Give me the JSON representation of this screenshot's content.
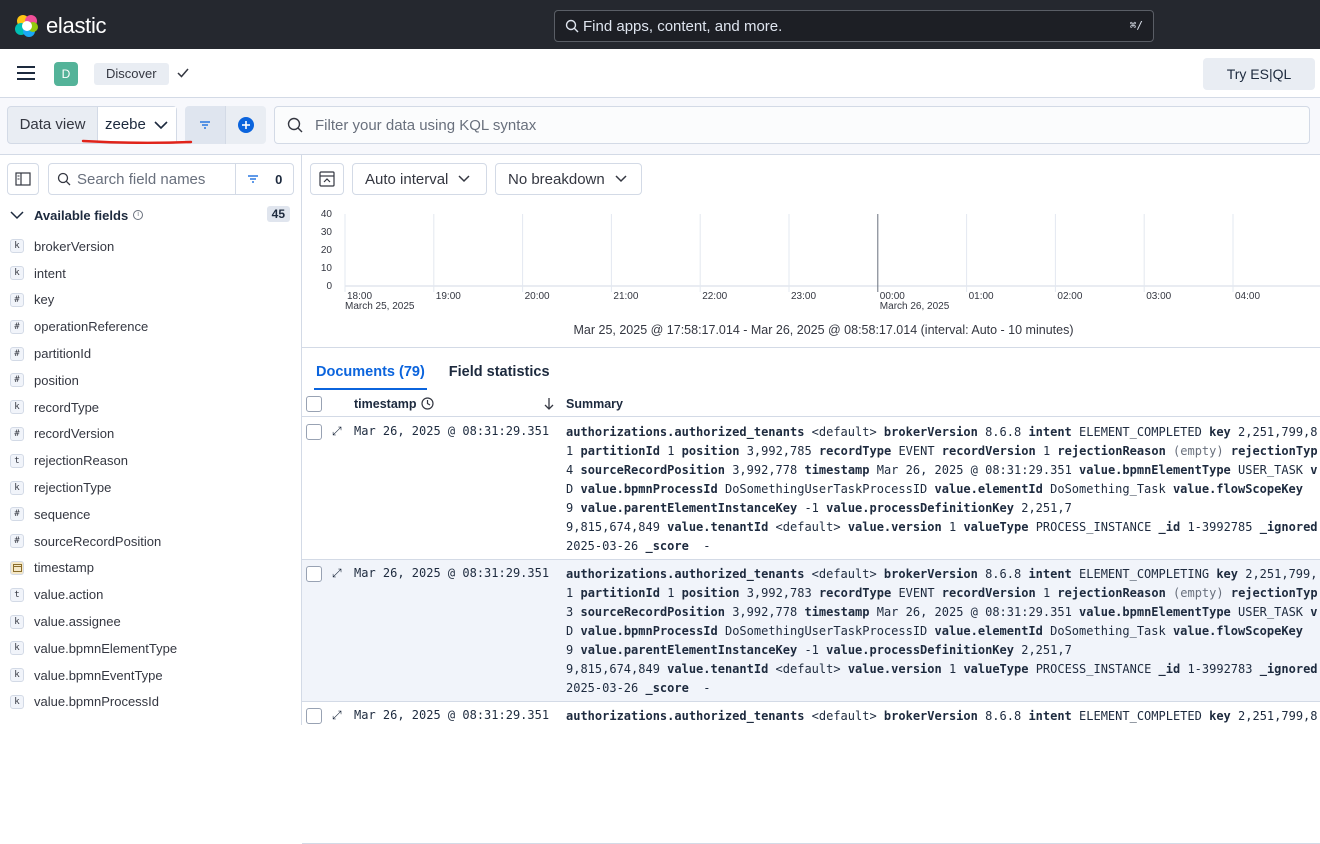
{
  "topbar": {
    "brand": "elastic",
    "search_placeholder": "Find apps, content, and more.",
    "shortcut": "⌘/"
  },
  "header": {
    "space_initial": "D",
    "breadcrumb": "Discover",
    "esql_button": "Try ES|QL"
  },
  "query": {
    "dataview_label": "Data view",
    "dataview_value": "zeebe",
    "kql_placeholder": "Filter your data using KQL syntax"
  },
  "sidebar": {
    "search_placeholder": "Search field names",
    "filter_count": "0",
    "available_label": "Available fields",
    "available_count": "45",
    "fields": [
      {
        "type": "k",
        "name": "brokerVersion"
      },
      {
        "type": "k",
        "name": "intent"
      },
      {
        "type": "#",
        "name": "key"
      },
      {
        "type": "#",
        "name": "operationReference"
      },
      {
        "type": "#",
        "name": "partitionId"
      },
      {
        "type": "#",
        "name": "position"
      },
      {
        "type": "k",
        "name": "recordType"
      },
      {
        "type": "#",
        "name": "recordVersion"
      },
      {
        "type": "t",
        "name": "rejectionReason"
      },
      {
        "type": "k",
        "name": "rejectionType"
      },
      {
        "type": "#",
        "name": "sequence"
      },
      {
        "type": "#",
        "name": "sourceRecordPosition"
      },
      {
        "type": "cal",
        "name": "timestamp"
      },
      {
        "type": "t",
        "name": "value.action"
      },
      {
        "type": "k",
        "name": "value.assignee"
      },
      {
        "type": "k",
        "name": "value.bpmnElementType"
      },
      {
        "type": "k",
        "name": "value.bpmnEventType"
      },
      {
        "type": "k",
        "name": "value.bpmnProcessId"
      }
    ]
  },
  "toolbar": {
    "interval": "Auto interval",
    "breakdown": "No breakdown"
  },
  "histogram": {
    "y_ticks": [
      "40",
      "30",
      "20",
      "10",
      "0"
    ],
    "x_ticks": [
      "18:00",
      "19:00",
      "20:00",
      "21:00",
      "22:00",
      "23:00",
      "00:00",
      "01:00",
      "02:00",
      "03:00",
      "04:00"
    ],
    "date_labels": [
      "March 25, 2025",
      "March 26, 2025"
    ],
    "range": "Mar 25, 2025 @ 17:58:17.014 - Mar 26, 2025 @ 08:58:17.014 (interval: Auto - 10 minutes)"
  },
  "tabs": [
    "Documents (79)",
    "Field statistics"
  ],
  "table": {
    "col_timestamp": "timestamp",
    "col_summary": "Summary",
    "rows": [
      {
        "ts": "Mar 26, 2025 @ 08:31:29.351",
        "intent": "ELEMENT_COMPLETED",
        "key": "2,251,799,8",
        "sev": "4",
        "id": "1-3992785",
        "ignored": "_ignored",
        "position": "3,992,785"
      },
      {
        "ts": "Mar 26, 2025 @ 08:31:29.351",
        "intent": "ELEMENT_COMPLETING",
        "key": "2,251,799,",
        "sev": "3",
        "id": "1-3992783",
        "ignored": "_ignored",
        "position": "3,992,783"
      },
      {
        "ts": "Mar 26, 2025 @ 08:31:29.351",
        "intent": "ELEMENT_COMPLETED",
        "key": "2,251,799,8",
        "sev": "",
        "id": "",
        "ignored": "",
        "position": ""
      }
    ],
    "summary_common": {
      "tenants_label": "authorizations.authorized_tenants",
      "tenants_value": "<default>",
      "broker_label": "brokerVersion",
      "broker_value": "8.6.8",
      "intent_label": "intent",
      "key_label": "key",
      "partition_label": "partitionId",
      "position_label": "position",
      "record_type_label": "recordType",
      "record_type_value": "EVENT",
      "record_version_label": "recordVersion",
      "rejection_reason_label": "rejectionReason",
      "empty": "(empty)",
      "rejection_type_label": "rejectionTyp",
      "srp_label": "sourceRecordPosition",
      "srp_value": "3,992,778",
      "timestamp_label": "timestamp",
      "timestamp_value": "Mar 26, 2025 @ 08:31:29.351",
      "elemtype_label": "value.bpmnElementType",
      "elemtype_value": "USER_TASK",
      "v": "v",
      "d": "D",
      "process_id_label": "value.bpmnProcessId",
      "process_id_value": "DoSomethingUserTaskProcessID",
      "element_id_label": "value.elementId",
      "element_id_value": "DoSomething_Task",
      "flow_label": "value.flowScopeKey",
      "nine": "9",
      "parent_label": "value.parentElementInstanceKey",
      "minus_one": "-1",
      "def_label": "value.processDefinitionKey",
      "def_value": "2,251,7",
      "big": "9,815,674,849",
      "tenant_label": "value.tenantId",
      "version_label": "value.version",
      "value_type_label": "valueType",
      "value_type_value": "PROCESS_INSTANCE",
      "id_label": "_id",
      "date": "2025-03-26",
      "score_label": "_score",
      "dash": "-",
      "one": "1"
    }
  }
}
